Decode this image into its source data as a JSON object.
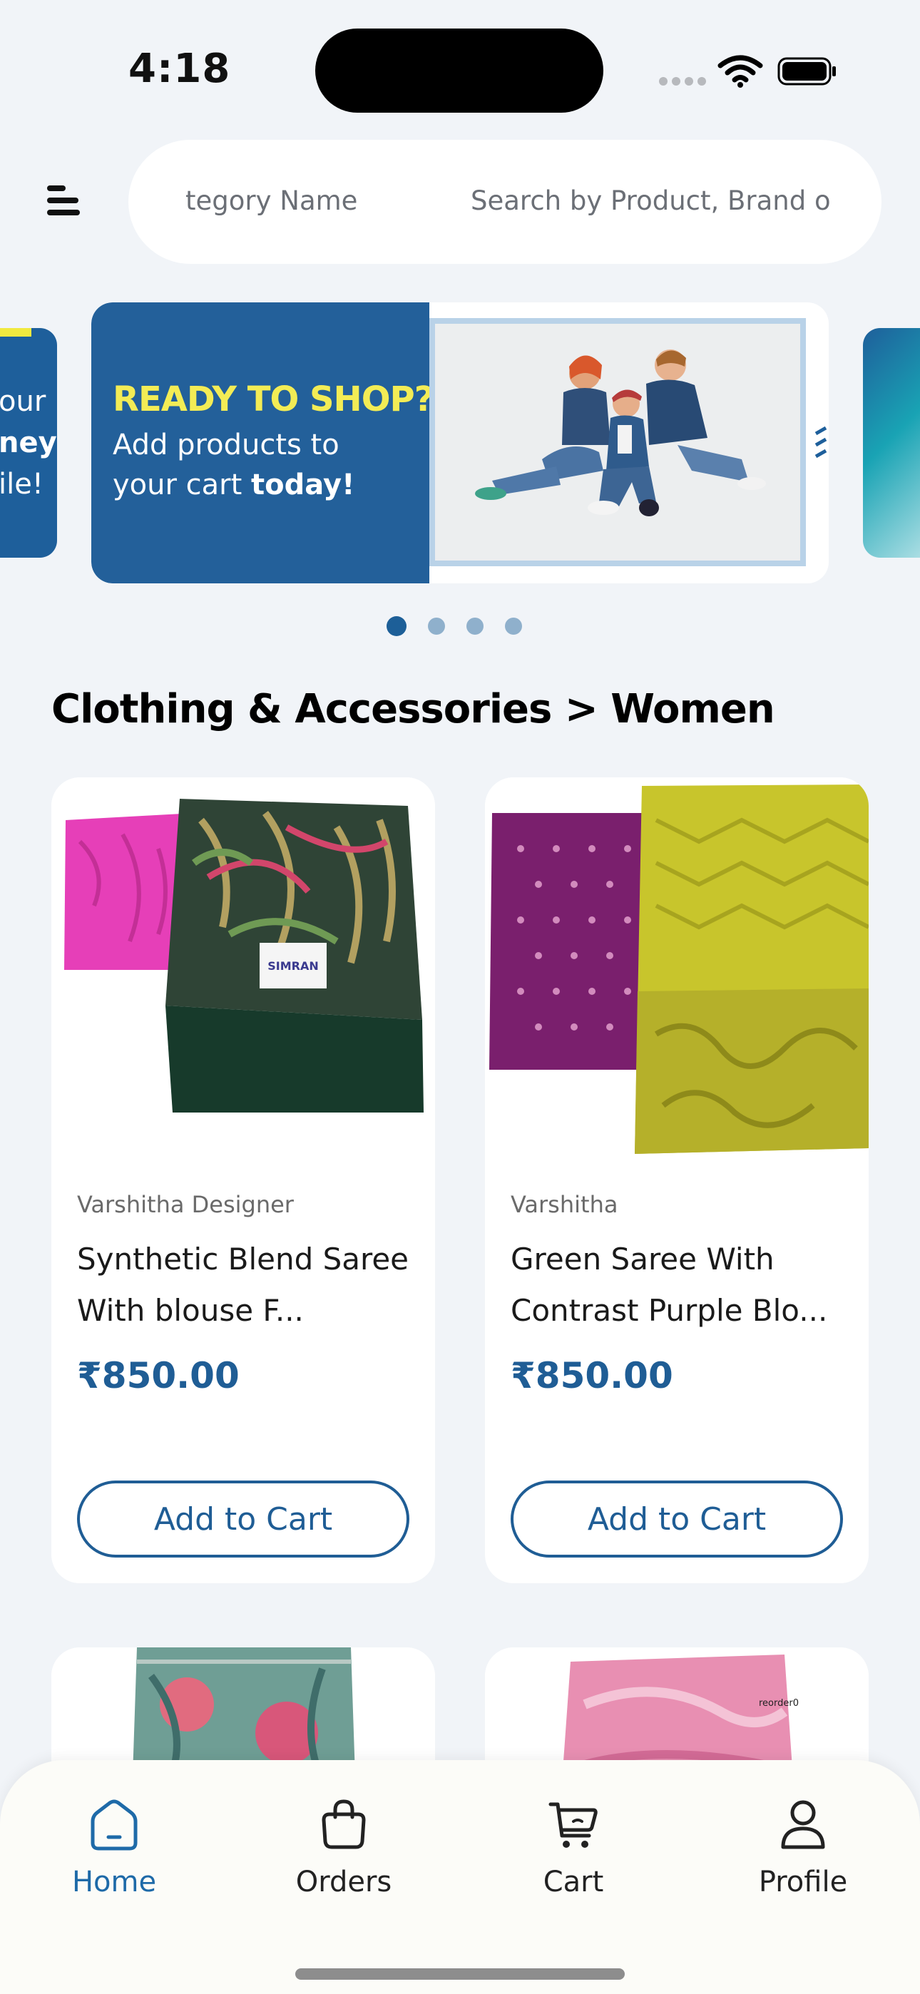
{
  "status_bar": {
    "time": "4:18"
  },
  "header": {
    "search_category": "tegory Name",
    "search_placeholder": "Search by Product, Brand o"
  },
  "banner": {
    "headline": "READY TO SHOP?",
    "subline_1": "Add products to",
    "subline_2_prefix": "your cart ",
    "subline_2_bold": "today!",
    "left_peek_lines": [
      "our",
      "ney",
      "ile!"
    ],
    "dots_count": 4,
    "active_dot": 0
  },
  "section": {
    "title": "Clothing & Accessories > Women"
  },
  "products": [
    {
      "brand": "Varshitha Designer",
      "name": "Synthetic Blend Saree With blouse F...",
      "price": "₹850.00",
      "button": "Add to Cart",
      "tag_text": "SIMRAN"
    },
    {
      "brand": "Varshitha",
      "name": "Green Saree With Contrast Purple Blo...",
      "price": "₹850.00",
      "button": "Add to Cart"
    }
  ],
  "partial_products": [
    {
      "tag_text": "reorder0"
    }
  ],
  "bottom_nav": {
    "items": [
      {
        "label": "Home",
        "icon": "home-icon",
        "active": true
      },
      {
        "label": "Orders",
        "icon": "bag-icon",
        "active": false
      },
      {
        "label": "Cart",
        "icon": "cart-icon",
        "active": false
      },
      {
        "label": "Profile",
        "icon": "profile-icon",
        "active": false
      }
    ]
  },
  "colors": {
    "brand_blue": "#1f5d95",
    "banner_yellow": "#f3ec55",
    "active_nav": "#1e6aa8",
    "background": "#f1f4f8"
  }
}
